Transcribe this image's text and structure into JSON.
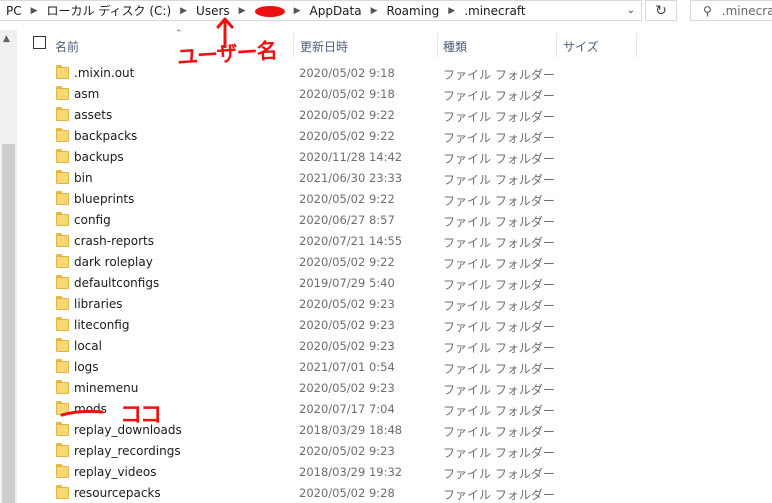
{
  "address": {
    "crumbs": [
      "PC",
      "ローカル ディスク (C:)",
      "Users",
      "",
      "AppData",
      "Roaming",
      ".minecraft"
    ],
    "refresh_icon": "refresh-icon",
    "search_placeholder": ".minecraft"
  },
  "headers": {
    "name": "名前",
    "date": "更新日時",
    "type": "種類",
    "size": "サイズ"
  },
  "rows": [
    {
      "name": ".mixin.out",
      "date": "2020/05/02 9:18",
      "type": "ファイル フォルダー"
    },
    {
      "name": "asm",
      "date": "2020/05/02 9:18",
      "type": "ファイル フォルダー"
    },
    {
      "name": "assets",
      "date": "2020/05/02 9:22",
      "type": "ファイル フォルダー"
    },
    {
      "name": "backpacks",
      "date": "2020/05/02 9:22",
      "type": "ファイル フォルダー"
    },
    {
      "name": "backups",
      "date": "2020/11/28 14:42",
      "type": "ファイル フォルダー"
    },
    {
      "name": "bin",
      "date": "2021/06/30 23:33",
      "type": "ファイル フォルダー"
    },
    {
      "name": "blueprints",
      "date": "2020/05/02 9:22",
      "type": "ファイル フォルダー"
    },
    {
      "name": "config",
      "date": "2020/06/27 8:57",
      "type": "ファイル フォルダー"
    },
    {
      "name": "crash-reports",
      "date": "2020/07/21 14:55",
      "type": "ファイル フォルダー"
    },
    {
      "name": "dark roleplay",
      "date": "2020/05/02 9:22",
      "type": "ファイル フォルダー"
    },
    {
      "name": "defaultconfigs",
      "date": "2019/07/29 5:40",
      "type": "ファイル フォルダー"
    },
    {
      "name": "libraries",
      "date": "2020/05/02 9:23",
      "type": "ファイル フォルダー"
    },
    {
      "name": "liteconfig",
      "date": "2020/05/02 9:23",
      "type": "ファイル フォルダー"
    },
    {
      "name": "local",
      "date": "2020/05/02 9:23",
      "type": "ファイル フォルダー"
    },
    {
      "name": "logs",
      "date": "2021/07/01 0:54",
      "type": "ファイル フォルダー"
    },
    {
      "name": "minemenu",
      "date": "2020/05/02 9:23",
      "type": "ファイル フォルダー"
    },
    {
      "name": "mods",
      "date": "2020/07/17 7:04",
      "type": "ファイル フォルダー"
    },
    {
      "name": "replay_downloads",
      "date": "2018/03/29 18:48",
      "type": "ファイル フォルダー"
    },
    {
      "name": "replay_recordings",
      "date": "2020/05/02 9:23",
      "type": "ファイル フォルダー"
    },
    {
      "name": "replay_videos",
      "date": "2018/03/29 19:32",
      "type": "ファイル フォルダー"
    },
    {
      "name": "resourcepacks",
      "date": "2020/05/02 9:28",
      "type": "ファイル フォルダー"
    }
  ],
  "annotations": {
    "username_label": "ユーザー名",
    "here_label": "ココ",
    "color": "#ee1111"
  },
  "colors": {
    "header_text": "#4c607a",
    "folder_fill": "#f8d775",
    "secondary_text": "#6d6d6d"
  }
}
